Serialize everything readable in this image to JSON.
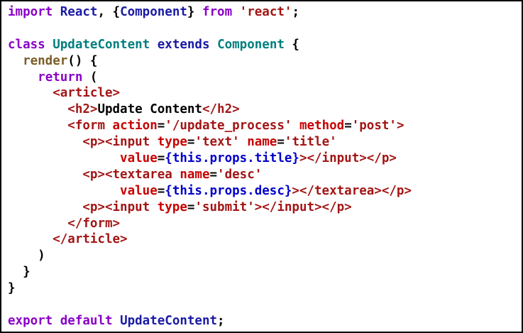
{
  "editor": {
    "colors": {
      "kw": "#8a00c8",
      "cls": "#007f7f",
      "ident": "#1a1aa6",
      "str": "#a31515",
      "tag": "#a31515",
      "attr": "#c80000",
      "plain": "#000000",
      "fn": "#795e26",
      "jsx": "#0000cc"
    },
    "lines": [
      [
        [
          "kw",
          "import"
        ],
        [
          "plain",
          " "
        ],
        [
          "ident",
          "React"
        ],
        [
          "plain",
          ", {"
        ],
        [
          "ident",
          "Component"
        ],
        [
          "plain",
          "} "
        ],
        [
          "kw",
          "from"
        ],
        [
          "plain",
          " "
        ],
        [
          "str",
          "'react'"
        ],
        [
          "plain",
          ";"
        ]
      ],
      [],
      [
        [
          "kw",
          "class"
        ],
        [
          "plain",
          " "
        ],
        [
          "cls",
          "UpdateContent"
        ],
        [
          "plain",
          " "
        ],
        [
          "ident",
          "extends"
        ],
        [
          "plain",
          " "
        ],
        [
          "cls",
          "Component"
        ],
        [
          "plain",
          " {"
        ]
      ],
      [
        [
          "plain",
          "  "
        ],
        [
          "fn",
          "render"
        ],
        [
          "plain",
          "() {"
        ]
      ],
      [
        [
          "plain",
          "    "
        ],
        [
          "kw",
          "return"
        ],
        [
          "plain",
          " ("
        ]
      ],
      [
        [
          "plain",
          "      "
        ],
        [
          "tag",
          "<article>"
        ]
      ],
      [
        [
          "plain",
          "        "
        ],
        [
          "tag",
          "<h2>"
        ],
        [
          "plain",
          "Update Content"
        ],
        [
          "tag",
          "</h2>"
        ]
      ],
      [
        [
          "plain",
          "        "
        ],
        [
          "tag",
          "<form"
        ],
        [
          "plain",
          " "
        ],
        [
          "attr",
          "action"
        ],
        [
          "plain",
          "="
        ],
        [
          "str",
          "'/update_process'"
        ],
        [
          "plain",
          " "
        ],
        [
          "attr",
          "method"
        ],
        [
          "plain",
          "="
        ],
        [
          "str",
          "'post'"
        ],
        [
          "tag",
          ">"
        ]
      ],
      [
        [
          "plain",
          "          "
        ],
        [
          "tag",
          "<p><input"
        ],
        [
          "plain",
          " "
        ],
        [
          "attr",
          "type"
        ],
        [
          "plain",
          "="
        ],
        [
          "str",
          "'text'"
        ],
        [
          "plain",
          " "
        ],
        [
          "attr",
          "name"
        ],
        [
          "plain",
          "="
        ],
        [
          "str",
          "'title'"
        ]
      ],
      [
        [
          "plain",
          "               "
        ],
        [
          "attr",
          "value"
        ],
        [
          "plain",
          "="
        ],
        [
          "jsx",
          "{this.props.title}"
        ],
        [
          "tag",
          "></input></p>"
        ]
      ],
      [
        [
          "plain",
          "          "
        ],
        [
          "tag",
          "<p><textarea"
        ],
        [
          "plain",
          " "
        ],
        [
          "attr",
          "name"
        ],
        [
          "plain",
          "="
        ],
        [
          "str",
          "'desc'"
        ]
      ],
      [
        [
          "plain",
          "               "
        ],
        [
          "attr",
          "value"
        ],
        [
          "plain",
          "="
        ],
        [
          "jsx",
          "{this.props.desc}"
        ],
        [
          "tag",
          "></textarea></p>"
        ]
      ],
      [
        [
          "plain",
          "          "
        ],
        [
          "tag",
          "<p><input"
        ],
        [
          "plain",
          " "
        ],
        [
          "attr",
          "type"
        ],
        [
          "plain",
          "="
        ],
        [
          "str",
          "'submit'"
        ],
        [
          "tag",
          "></input></p>"
        ]
      ],
      [
        [
          "plain",
          "        "
        ],
        [
          "tag",
          "</form>"
        ]
      ],
      [
        [
          "plain",
          "      "
        ],
        [
          "tag",
          "</article>"
        ]
      ],
      [
        [
          "plain",
          "    )"
        ]
      ],
      [
        [
          "plain",
          "  }"
        ]
      ],
      [
        [
          "plain",
          "}"
        ]
      ],
      [],
      [
        [
          "kw",
          "export"
        ],
        [
          "plain",
          " "
        ],
        [
          "kw",
          "default"
        ],
        [
          "plain",
          " "
        ],
        [
          "ident",
          "UpdateContent"
        ],
        [
          "plain",
          ";"
        ]
      ]
    ]
  }
}
